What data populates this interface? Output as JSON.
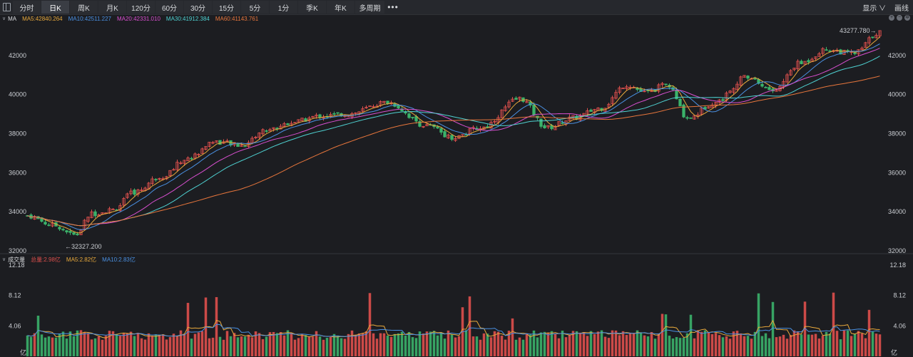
{
  "toolbar": {
    "tabs": [
      "分时",
      "日K",
      "周K",
      "月K",
      "120分",
      "60分",
      "30分",
      "15分",
      "5分",
      "1分",
      "季K",
      "年K",
      "多周期"
    ],
    "active_tab": "日K",
    "more_label": "•••",
    "display_label": "显示 ∨",
    "draw_label": "画线"
  },
  "legend": {
    "name": "MA",
    "ma5": "MA5:42840.264",
    "ma10": "MA10:42511.227",
    "ma20": "MA20:42331.010",
    "ma30": "MA30:41912.384",
    "ma60": "MA60:41143.761"
  },
  "volume_legend": {
    "name": "成交量",
    "total": "总量:2.98亿",
    "ma5": "MA5:2.82亿",
    "ma10": "MA10:2.83亿"
  },
  "colors": {
    "up": "#e0504d",
    "down": "#3bb36a",
    "ma5": "#e8a93c",
    "ma10": "#4a90e2",
    "ma20": "#d94fd0",
    "ma30": "#4fd2d2",
    "ma60": "#e8763c"
  },
  "price_axis": {
    "ticks": [
      "42000",
      "40000",
      "38000",
      "36000",
      "34000",
      "32000"
    ],
    "tick_values": [
      42000,
      40000,
      38000,
      36000,
      34000,
      32000
    ],
    "range": [
      32000,
      43600
    ]
  },
  "volume_axis": {
    "ticks": [
      "12.18",
      "8.12",
      "4.06",
      "亿"
    ],
    "tick_values": [
      12.18,
      8.12,
      4.06
    ],
    "range": [
      0,
      12.18
    ]
  },
  "annotations": {
    "high": "43277.780→",
    "low": "←32327.200"
  },
  "chart_data": {
    "type": "candlestick",
    "candle_count": 240,
    "anchors": [
      {
        "i": 0,
        "p": 33800
      },
      {
        "i": 10,
        "p": 33300
      },
      {
        "i": 18,
        "p": 32800
      },
      {
        "i": 24,
        "p": 33900
      },
      {
        "i": 32,
        "p": 34100
      },
      {
        "i": 40,
        "p": 35000
      },
      {
        "i": 50,
        "p": 35800
      },
      {
        "i": 60,
        "p": 36700
      },
      {
        "i": 70,
        "p": 37600
      },
      {
        "i": 80,
        "p": 37400
      },
      {
        "i": 90,
        "p": 38200
      },
      {
        "i": 100,
        "p": 38600
      },
      {
        "i": 110,
        "p": 38900
      },
      {
        "i": 120,
        "p": 39000
      },
      {
        "i": 135,
        "p": 39600
      },
      {
        "i": 150,
        "p": 38400
      },
      {
        "i": 160,
        "p": 37800
      },
      {
        "i": 170,
        "p": 38300
      },
      {
        "i": 185,
        "p": 39800
      },
      {
        "i": 195,
        "p": 38300
      },
      {
        "i": 205,
        "p": 38800
      },
      {
        "i": 215,
        "p": 39300
      },
      {
        "i": 225,
        "p": 40500
      },
      {
        "i": 232,
        "p": 40100
      },
      {
        "i": 240,
        "p": 40500
      },
      {
        "i": 248,
        "p": 38800
      },
      {
        "i": 258,
        "p": 39600
      },
      {
        "i": 270,
        "p": 40900
      },
      {
        "i": 280,
        "p": 40200
      },
      {
        "i": 290,
        "p": 41600
      },
      {
        "i": 300,
        "p": 42300
      },
      {
        "i": 310,
        "p": 42100
      },
      {
        "i": 320,
        "p": 43200
      }
    ],
    "high": 43277.78,
    "low": 32327.2
  }
}
